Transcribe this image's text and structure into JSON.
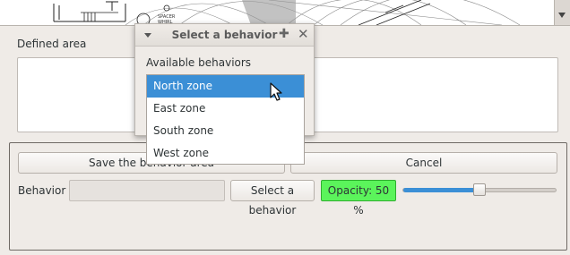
{
  "map": {},
  "defined_area": {
    "label": "Defined area"
  },
  "actions": {
    "save_label": "Save the behavior area",
    "cancel_label": "Cancel"
  },
  "behavior": {
    "label": "Behavior",
    "value": "",
    "select_label": "Select a behavior"
  },
  "opacity": {
    "text": "Opacity: 50 %",
    "value": 0.5
  },
  "dialog": {
    "title": "Select a behavior",
    "list_label": "Available behaviors",
    "items": [
      "North zone",
      "East zone",
      "South zone",
      "West zone"
    ],
    "selected_index": 0
  },
  "colors": {
    "selection": "#3b8fd6",
    "opacity_badge": "#5bf45b"
  }
}
